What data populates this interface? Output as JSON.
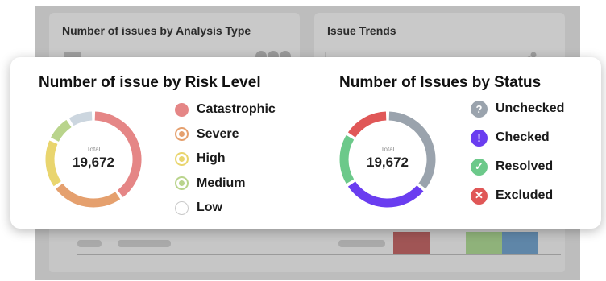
{
  "background": {
    "card1_title": "Number of issues by Analysis Type",
    "card2_title": "Issue Trends"
  },
  "risk": {
    "title": "Number of issue by Risk Level",
    "total_label": "Total",
    "total_value": "19,672",
    "legend": [
      {
        "label": "Catastrophic",
        "color": "#e58686",
        "style": "fill",
        "share": 0.4
      },
      {
        "label": "Severe",
        "color": "#e5a06e",
        "style": "ring",
        "share": 0.25
      },
      {
        "label": "High",
        "color": "#e9d56e",
        "style": "ring",
        "share": 0.17
      },
      {
        "label": "Medium",
        "color": "#b9d48c",
        "style": "ring",
        "share": 0.09
      },
      {
        "label": "Low",
        "color": "#ccd6df",
        "style": "empty",
        "share": 0.09
      }
    ]
  },
  "status": {
    "title": "Number of Issues by Status",
    "total_label": "Total",
    "total_value": "19,672",
    "legend": [
      {
        "label": "Unchecked",
        "color": "#9aa3ad",
        "icon": "question-circle-icon",
        "glyph": "?",
        "share": 0.36
      },
      {
        "label": "Checked",
        "color": "#6a3df0",
        "icon": "exclamation-circle-icon",
        "glyph": "!",
        "share": 0.3
      },
      {
        "label": "Resolved",
        "color": "#6cc98a",
        "icon": "check-circle-icon",
        "glyph": "✓",
        "share": 0.18
      },
      {
        "label": "Excluded",
        "color": "#e05757",
        "icon": "x-circle-icon",
        "glyph": "✕",
        "share": 0.16
      }
    ]
  }
}
